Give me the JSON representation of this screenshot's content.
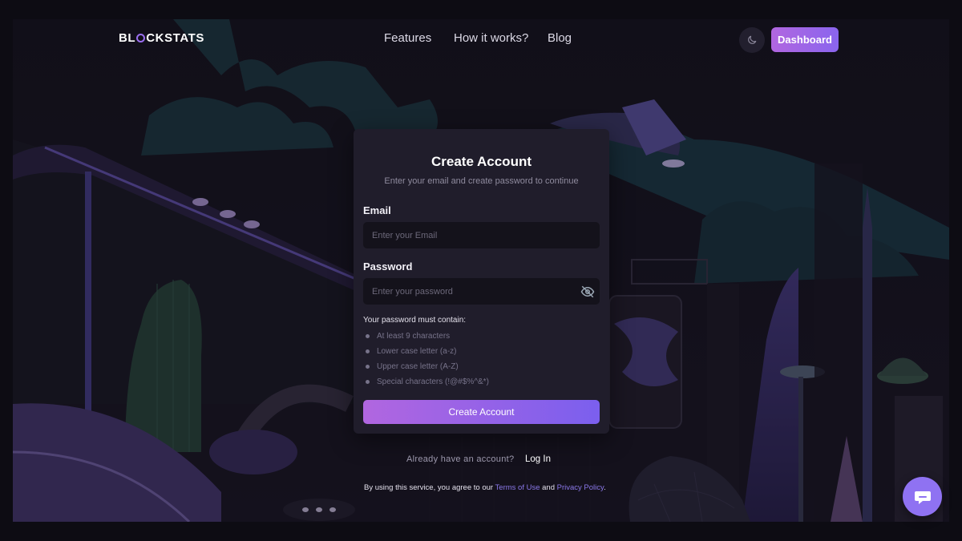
{
  "brand": {
    "name_start": "BL",
    "name_end": "CKSTATS"
  },
  "nav": {
    "features": "Features",
    "how_it_works": "How it works?",
    "blog": "Blog",
    "dashboard": "Dashboard"
  },
  "form": {
    "title": "Create Account",
    "subtitle": "Enter your email and create password to continue",
    "email_label": "Email",
    "email_placeholder": "Enter your Email",
    "password_label": "Password",
    "password_placeholder": "Enter your password",
    "rules_title": "Your password must contain:",
    "rules": [
      "At least 9 characters",
      "Lower case letter (a-z)",
      "Upper case letter (A-Z)",
      "Special characters (!@#$%^&*)"
    ],
    "submit": "Create Account"
  },
  "footer": {
    "already": "Already have an account?",
    "login": "Log In",
    "terms_prefix": "By using this service, you agree to our ",
    "terms_link": "Terms of Use",
    "and": " and ",
    "privacy_link": "Privacy Policy",
    "terms_suffix": "."
  },
  "icons": {
    "theme": "moon-icon",
    "password_toggle": "eye-off-icon",
    "chat": "chat-bubble-icon"
  },
  "colors": {
    "accent_start": "#b166e0",
    "accent_end": "#7b5fee",
    "link": "#8a78e8",
    "background": "#15131d",
    "card": "#201d2b"
  }
}
